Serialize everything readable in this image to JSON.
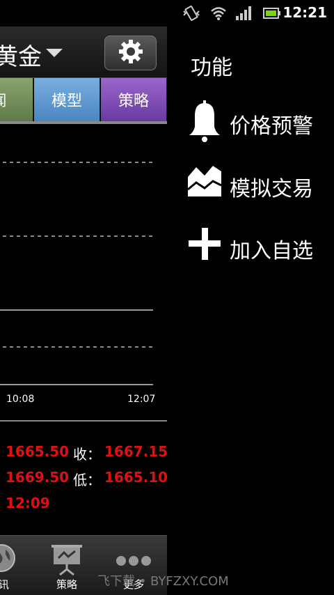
{
  "status_bar": {
    "time": "12:21",
    "icons": [
      "vibrate-icon",
      "wifi-icon",
      "signal-icon",
      "battery-icon"
    ]
  },
  "header": {
    "title": "黄金",
    "settings_icon": "gear-icon"
  },
  "tabs": [
    {
      "label": "闻"
    },
    {
      "label": "模型"
    },
    {
      "label": "策略"
    }
  ],
  "chart": {
    "x_labels": [
      "10:08",
      "12:07"
    ]
  },
  "quotes": {
    "row1_left": "1665.50",
    "row1_label": "收：",
    "row1_right": "1667.15",
    "row2_left": "1669.50",
    "row2_label": "低：",
    "row2_right": "1665.10",
    "row3_left": "12:09"
  },
  "bottom_nav": [
    {
      "label": "讯",
      "icon": "globe-icon"
    },
    {
      "label": "策略",
      "icon": "presentation-icon"
    },
    {
      "label": "更多",
      "icon": "more-dots-icon"
    }
  ],
  "drawer": {
    "title": "功能",
    "items": [
      {
        "label": "价格预警",
        "icon": "bell-icon"
      },
      {
        "label": "模拟交易",
        "icon": "area-chart-icon"
      },
      {
        "label": "加入自选",
        "icon": "plus-icon"
      }
    ]
  },
  "watermark": "飞下载 • BYFZXY.COM",
  "colors": {
    "price_red": "#e01010",
    "tab_news": "#6f8b56",
    "tab_model": "#5f99cf",
    "tab_strategy": "#824fb8"
  }
}
